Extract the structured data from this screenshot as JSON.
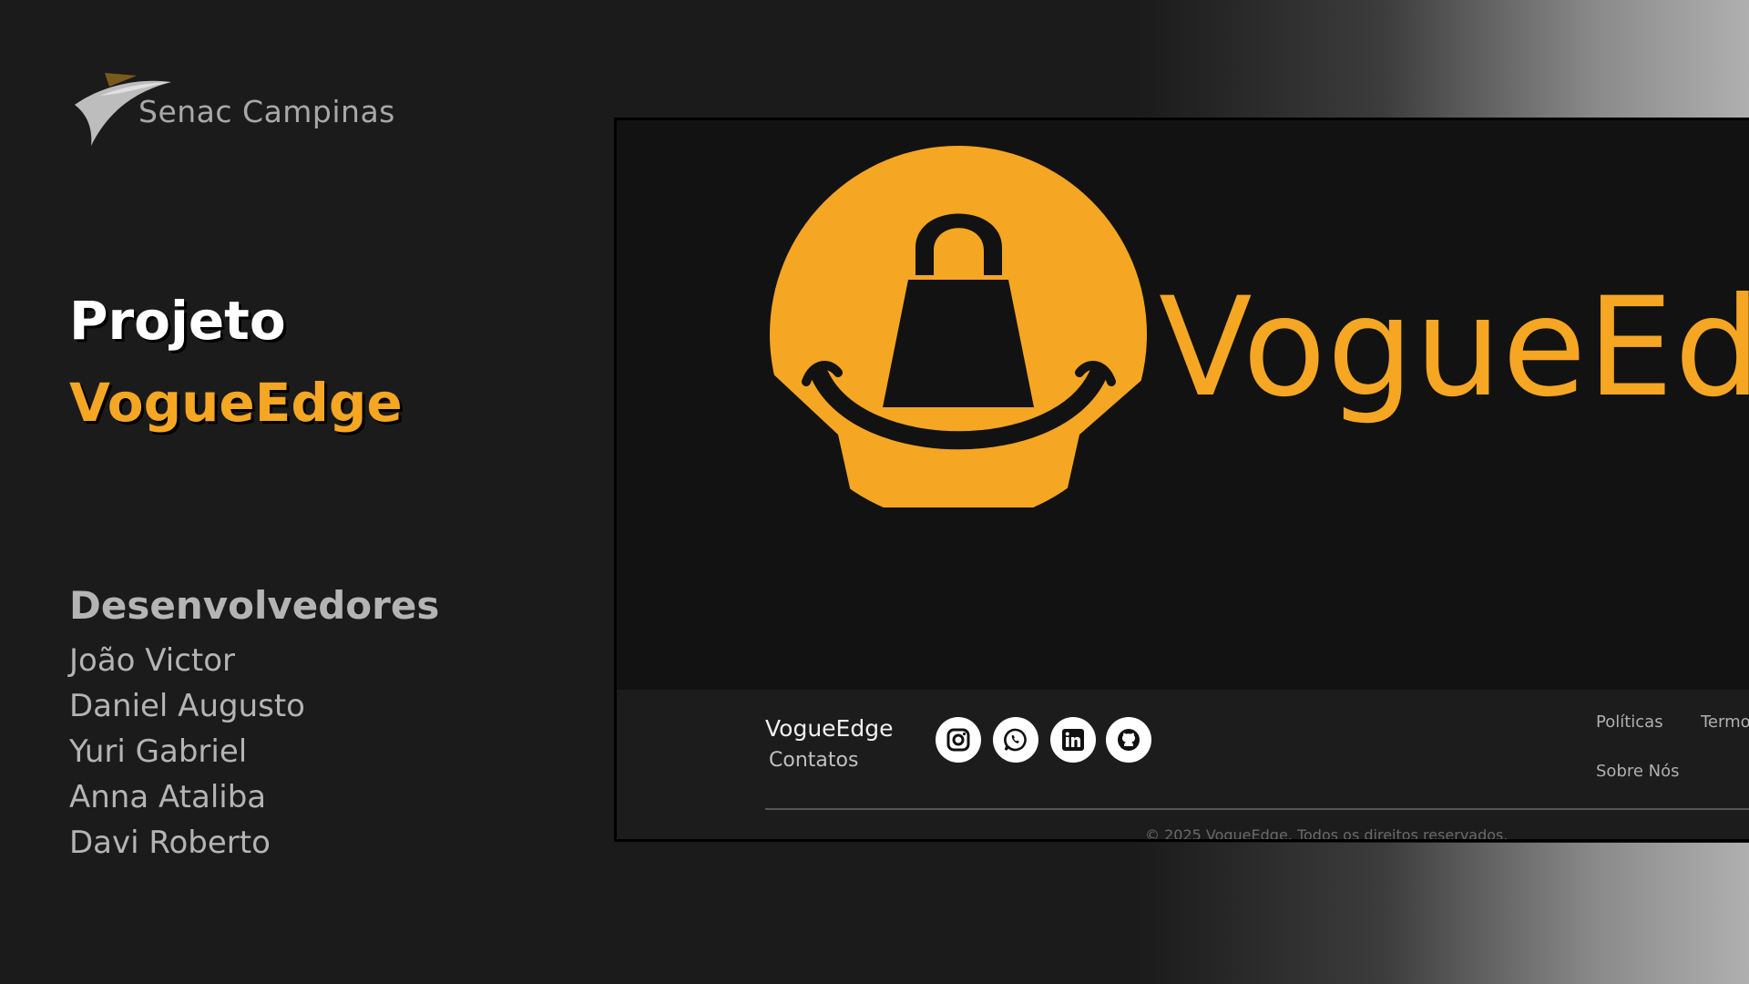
{
  "slide": {
    "institution": "Senac Campinas",
    "project_label": "Projeto",
    "project_name": "VogueEdge",
    "developers_heading": "Desenvolvedores",
    "developers": [
      "João Victor",
      "Daniel Augusto",
      "Yuri Gabriel",
      "Anna Ataliba",
      "Davi Roberto"
    ]
  },
  "site": {
    "brand": "VogueEdge",
    "footer": {
      "brand": "VogueEdge",
      "contacts_label": "Contatos",
      "social_icons": [
        "instagram-icon",
        "whatsapp-icon",
        "linkedin-icon",
        "github-icon"
      ],
      "links": [
        "Políticas",
        "Termo",
        "Sobre Nós"
      ],
      "copyright": "© 2025 VogueEdge. Todos os direitos reservados."
    }
  },
  "colors": {
    "accent": "#f5a623",
    "background": "#1b1b1b",
    "frame_background": "#121212",
    "footer_background": "#1c1c1c"
  }
}
